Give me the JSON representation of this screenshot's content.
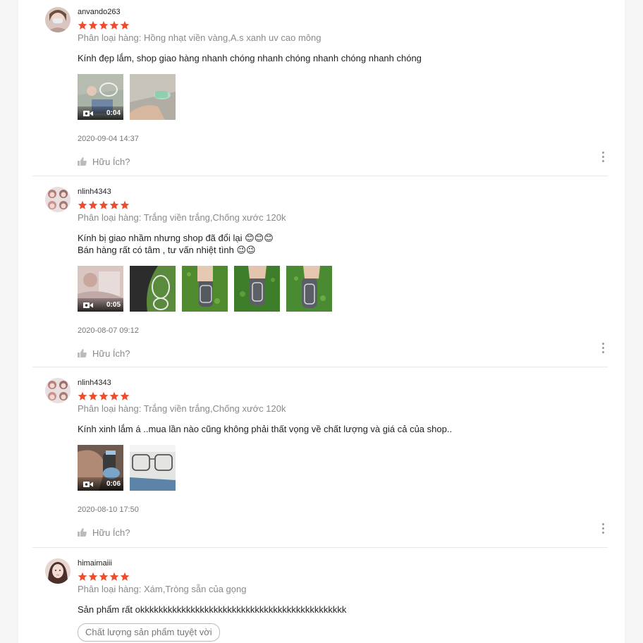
{
  "reviews": [
    {
      "username": "anvando263",
      "rating": 5,
      "variation": "Phân loại hàng: Hồng nhạt viền vàng,A.s xanh uv cao mông",
      "comment": [
        "Kính đẹp lắm, shop giao hàng nhanh chóng nhanh chóng nhanh chóng nhanh chóng"
      ],
      "media": [
        {
          "type": "video",
          "duration": "0:04"
        },
        {
          "type": "image"
        }
      ],
      "date": "2020-09-04 14:37",
      "helpful_label": "Hữu Ích?"
    },
    {
      "username": "nlinh4343",
      "rating": 5,
      "variation": "Phân loại hàng: Trắng viền trắng,Chống xước 120k",
      "comment": [
        "Kính bị giao nhầm nhưng shop đã đổi lại 😊😊😊",
        "Bán hàng rất có tâm , tư vấn nhiệt tình 😉😉"
      ],
      "media": [
        {
          "type": "video",
          "duration": "0:05"
        },
        {
          "type": "image"
        },
        {
          "type": "image"
        },
        {
          "type": "image"
        },
        {
          "type": "image"
        }
      ],
      "date": "2020-08-07 09:12",
      "helpful_label": "Hữu Ích?"
    },
    {
      "username": "nlinh4343",
      "rating": 5,
      "variation": "Phân loại hàng: Trắng viền trắng,Chống xước 120k",
      "comment": [
        "Kính xinh lắm á ..mua lần nào cũng không phải thất vọng về chất lượng và giá cả của shop.."
      ],
      "media": [
        {
          "type": "video",
          "duration": "0:06"
        },
        {
          "type": "image"
        }
      ],
      "date": "2020-08-10 17:50",
      "helpful_label": "Hữu Ích?"
    },
    {
      "username": "himaimaiii",
      "rating": 5,
      "variation": "Phân loại hàng: Xám,Tròng sẵn của gọng",
      "comment": [
        "Sản phẩm rất okkkkkkkkkkkkkkkkkkkkkkkkkkkkkkkkkkkkkkkkkkkkk"
      ],
      "tag": "Chất lượng sản phẩm tuyệt vời"
    }
  ],
  "colors": {
    "star": "#ee4d2d",
    "muted": "#8a8a8a",
    "divider": "#e8e8e8"
  }
}
